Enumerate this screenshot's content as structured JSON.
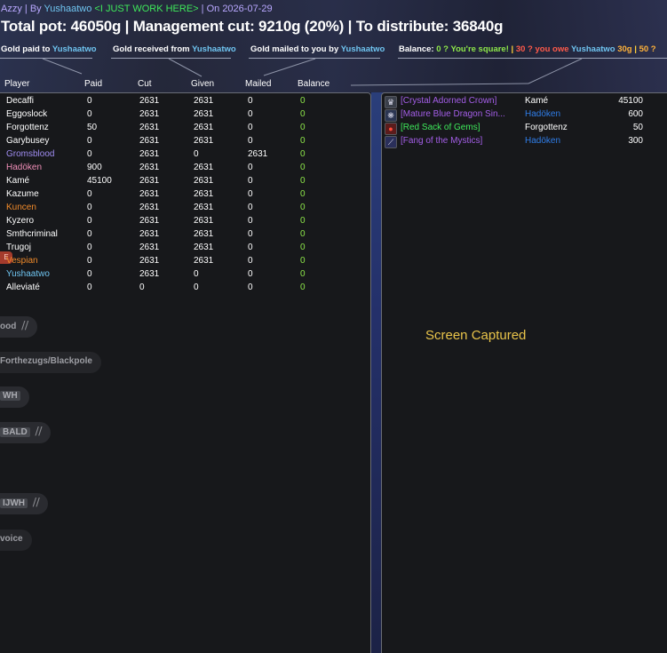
{
  "header": {
    "guild": "Azzy",
    "by_label": "By",
    "author": "Yushaatwo",
    "author_title": "<I JUST WORK HERE>",
    "on_label": "On",
    "date": "2026-07-29",
    "totals": "Total pot: 46050g | Management cut: 9210g (20%) | To distribute: 36840g"
  },
  "tabs": {
    "paid_label": "Gold paid to",
    "paid_name": "Yushaatwo",
    "received_label": "Gold received from",
    "received_name": "Yushaatwo",
    "mailed_label": "Gold mailed to you by",
    "mailed_name": "Yushaatwo"
  },
  "balance_legend": {
    "label": "Balance:",
    "square": "0 ? You're square!",
    "separator": "|",
    "owe_prefix": "30 ? you owe",
    "owe_name": "Yushaatwo",
    "owe_amount": "30g",
    "owed_partial": "50 ?"
  },
  "columns": {
    "player": "Player",
    "paid": "Paid",
    "cut": "Cut",
    "given": "Given",
    "mailed": "Mailed",
    "balance": "Balance"
  },
  "players": [
    {
      "name": "Decaffi",
      "color": "#ffffff",
      "paid": "0",
      "cut": "2631",
      "given": "2631",
      "mailed": "0",
      "balance": "0"
    },
    {
      "name": "Eggoslock",
      "color": "#ffffff",
      "paid": "0",
      "cut": "2631",
      "given": "2631",
      "mailed": "0",
      "balance": "0"
    },
    {
      "name": "Forgottenz",
      "color": "#ffffff",
      "paid": "50",
      "cut": "2631",
      "given": "2631",
      "mailed": "0",
      "balance": "0"
    },
    {
      "name": "Garybusey",
      "color": "#ffffff",
      "paid": "0",
      "cut": "2631",
      "given": "2631",
      "mailed": "0",
      "balance": "0"
    },
    {
      "name": "Gromsblood",
      "color": "#9f8cf0",
      "paid": "0",
      "cut": "2631",
      "given": "0",
      "mailed": "2631",
      "balance": "0"
    },
    {
      "name": "Hadöken",
      "color": "#f08fb8",
      "paid": "900",
      "cut": "2631",
      "given": "2631",
      "mailed": "0",
      "balance": "0"
    },
    {
      "name": "Kamé",
      "color": "#ffffff",
      "paid": "45100",
      "cut": "2631",
      "given": "2631",
      "mailed": "0",
      "balance": "0"
    },
    {
      "name": "Kazume",
      "color": "#ffffff",
      "paid": "0",
      "cut": "2631",
      "given": "2631",
      "mailed": "0",
      "balance": "0"
    },
    {
      "name": "Kuncen",
      "color": "#f08a2a",
      "paid": "0",
      "cut": "2631",
      "given": "2631",
      "mailed": "0",
      "balance": "0"
    },
    {
      "name": "Kyzero",
      "color": "#ffffff",
      "paid": "0",
      "cut": "2631",
      "given": "2631",
      "mailed": "0",
      "balance": "0"
    },
    {
      "name": "Smthcriminal",
      "color": "#ffffff",
      "paid": "0",
      "cut": "2631",
      "given": "2631",
      "mailed": "0",
      "balance": "0"
    },
    {
      "name": "Trugoj",
      "color": "#ffffff",
      "paid": "0",
      "cut": "2631",
      "given": "2631",
      "mailed": "0",
      "balance": "0"
    },
    {
      "name": "Vespian",
      "color": "#f08a2a",
      "paid": "0",
      "cut": "2631",
      "given": "2631",
      "mailed": "0",
      "balance": "0"
    },
    {
      "name": "Yushaatwo",
      "color": "#6fc4f0",
      "paid": "0",
      "cut": "2631",
      "given": "0",
      "mailed": "0",
      "balance": "0"
    },
    {
      "name": "Alleviaté",
      "color": "#ffffff",
      "paid": "0",
      "cut": "0",
      "given": "0",
      "mailed": "0",
      "balance": "0"
    }
  ],
  "items": [
    {
      "icon": "crown-icon",
      "glyph": "♛",
      "name": "[Crystal Adorned Crown]",
      "name_color": "#a45ee8",
      "winner": "Kamé",
      "winner_color": "#ffffff",
      "price": "45100"
    },
    {
      "icon": "dragon-icon",
      "glyph": "❋",
      "name": "[Mature Blue Dragon Sin...",
      "name_color": "#a45ee8",
      "winner": "Hadöken",
      "winner_color": "#2f7de8",
      "price": "600"
    },
    {
      "icon": "gem-sack-icon",
      "glyph": "●",
      "name": "[Red Sack of Gems]",
      "name_color": "#3ee85a",
      "winner": "Forgottenz",
      "winner_color": "#ffffff",
      "price": "50"
    },
    {
      "icon": "fang-icon",
      "glyph": "⟋",
      "name": "[Fang of the Mystics]",
      "name_color": "#a45ee8",
      "winner": "Hadöken",
      "winner_color": "#2f7de8",
      "price": "300"
    }
  ],
  "background_buttons": [
    {
      "label": "ood",
      "muted": true
    },
    {
      "label": "Forthezugs/Blackpole",
      "muted": false
    },
    {
      "label": "WH",
      "muted": false
    },
    {
      "label": "BALD",
      "muted": true
    },
    {
      "label": "IJWH",
      "muted": true
    },
    {
      "label": "voice",
      "muted": false
    }
  ],
  "status": {
    "screen_captured": "Screen Captured"
  }
}
